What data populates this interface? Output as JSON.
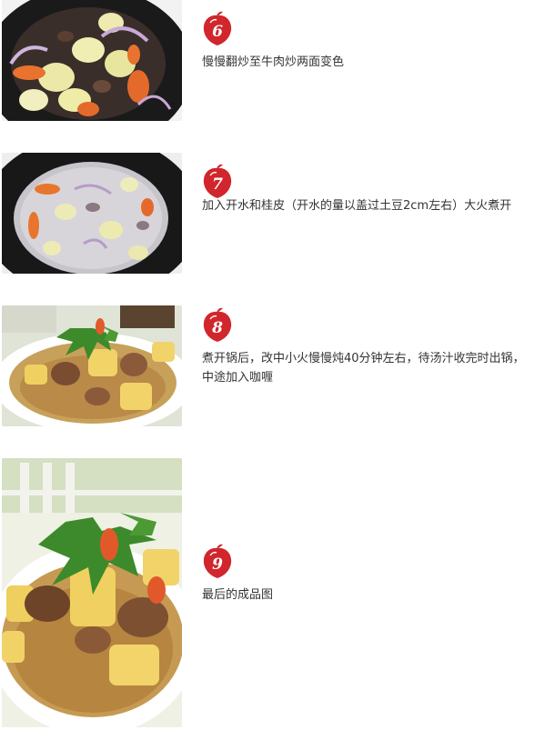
{
  "steps": [
    {
      "number": "6",
      "text": "慢慢翻炒至牛肉炒两面变色"
    },
    {
      "number": "7",
      "text": "加入开水和桂皮（开水的量以盖过土豆2cm左右）大火煮开"
    },
    {
      "number": "8",
      "text": "煮开锅后，改中小火慢慢炖40分钟左右，待汤汁收完时出锅，中途加入咖喱"
    },
    {
      "number": "9",
      "text": "最后的成品图"
    }
  ],
  "colors": {
    "badge_red": "#d0262c",
    "text": "#333333"
  }
}
